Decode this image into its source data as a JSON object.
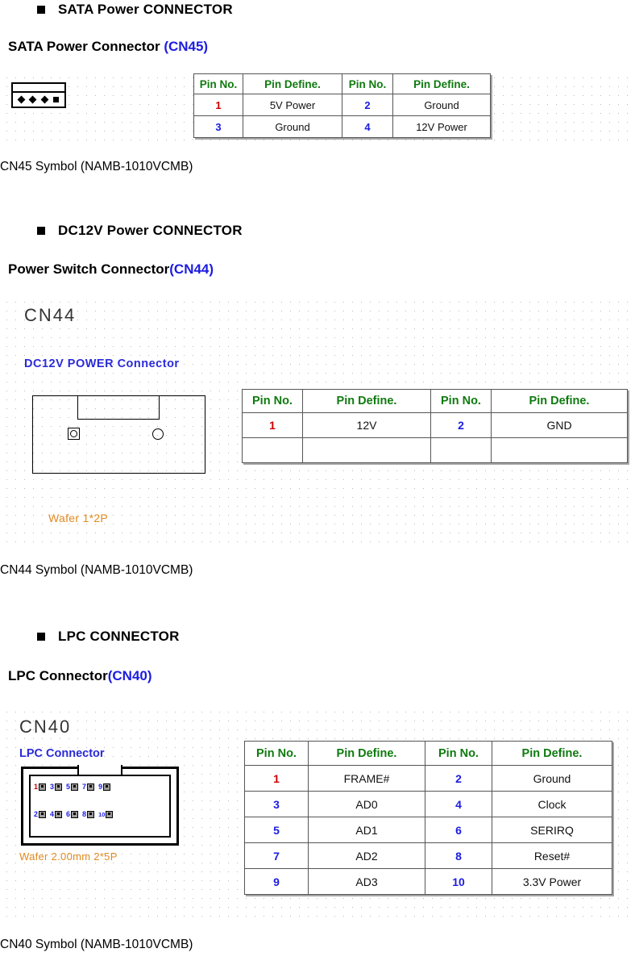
{
  "sections": [
    {
      "id": "sata",
      "heading": "SATA Power CONNECTOR",
      "subheading_black": "SATA Power Connector ",
      "subheading_blue": "(CN45)",
      "caption": "CN45 Symbol (NAMB-1010VCMB)",
      "table": {
        "headers": [
          "Pin No.",
          "Pin Define.",
          "Pin No.",
          "Pin Define."
        ],
        "rows": [
          [
            "1",
            "5V Power",
            "2",
            "Ground"
          ],
          [
            "3",
            "Ground",
            "4",
            "12V Power"
          ]
        ]
      }
    },
    {
      "id": "dc12v",
      "heading": "DC12V Power CONNECTOR",
      "subheading_black": "Power Switch Connector",
      "subheading_blue": "(CN44)",
      "caption": "CN44 Symbol (NAMB-1010VCMB)",
      "drawing": {
        "title": "CN44",
        "subtitle": "DC12V POWER Connector",
        "wafer": "Wafer 1*2P"
      },
      "table": {
        "headers": [
          "Pin No.",
          "Pin Define.",
          "Pin No.",
          "Pin Define."
        ],
        "rows": [
          [
            "1",
            "12V",
            "2",
            "GND"
          ],
          [
            "",
            "",
            "",
            ""
          ]
        ]
      }
    },
    {
      "id": "lpc",
      "heading": "LPC CONNECTOR",
      "subheading_black": "LPC Connector",
      "subheading_blue": "(CN40)",
      "caption": "CN40 Symbol (NAMB-1010VCMB)",
      "drawing": {
        "title": "CN40",
        "subtitle": "LPC Connector",
        "wafer": "Wafer 2.00mm 2*5P",
        "pins_top": [
          "1",
          "3",
          "5",
          "7",
          "9"
        ],
        "pins_bottom": [
          "2",
          "4",
          "6",
          "8",
          "10"
        ]
      },
      "table": {
        "headers": [
          "Pin No.",
          "Pin Define.",
          "Pin No.",
          "Pin Define."
        ],
        "rows": [
          [
            "1",
            "FRAME#",
            "2",
            "Ground"
          ],
          [
            "3",
            "AD0",
            "4",
            "Clock"
          ],
          [
            "5",
            "AD1",
            "6",
            "SERIRQ"
          ],
          [
            "7",
            "AD2",
            "8",
            "Reset#"
          ],
          [
            "9",
            "AD3",
            "10",
            "3.3V Power"
          ]
        ]
      }
    }
  ],
  "colors": {
    "header_green": "#0f7a0f",
    "pin_red": "#cc0000",
    "pin_blue": "#1c1ce0",
    "wafer_orange": "#e08a20",
    "title_blue": "#2a2ad8"
  }
}
